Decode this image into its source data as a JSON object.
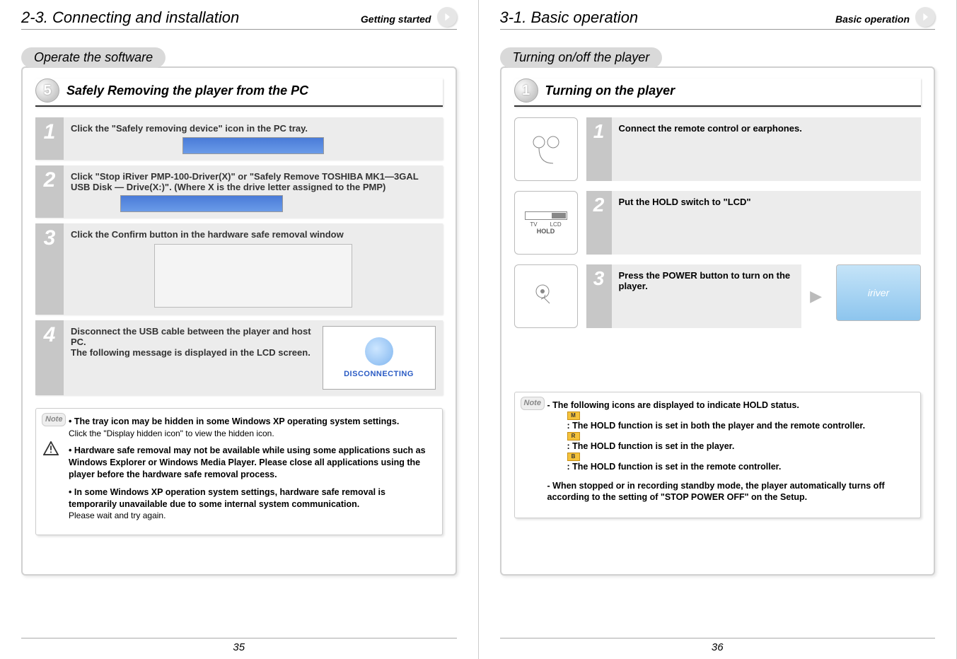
{
  "left": {
    "chapter": "2-3. Connecting and installation",
    "section": "Getting started",
    "tab": "Operate the software",
    "circleNum": "5",
    "subHeading": "Safely Removing the player from the PC",
    "steps": {
      "s1": {
        "num": "1",
        "text": "Click the \"Safely removing device\" icon in the PC tray."
      },
      "s2": {
        "num": "2",
        "text": "Click \"Stop iRiver PMP-100-Driver(X)\" or \"Safely Remove TOSHIBA MK1—3GAL USB Disk — Drive(X:)\". (Where X is the drive letter assigned to the PMP)"
      },
      "s3": {
        "num": "3",
        "text": "Click the Confirm button in the hardware safe removal window"
      },
      "s4": {
        "num": "4",
        "text": "Disconnect the USB cable between the player and host PC.\nThe following message is displayed in the LCD screen.",
        "imgLabel": "DISCONNECTING"
      }
    },
    "noteBadge": "Note",
    "notes": {
      "n1": "The tray icon may be hidden in some Windows XP operating system settings.",
      "n1sub": "Click the \"Display hidden icon\" to view the hidden icon.",
      "n2": "Hardware safe removal may not be available while using some applications such as Windows Explorer or Windows Media Player. Please close all applications using the player before the hardware safe removal process.",
      "n3": "In some Windows XP operation system settings, hardware safe removal is temporarily unavailable due to some internal system communication.",
      "n3sub": "Please wait and try again."
    },
    "pageNum": "35"
  },
  "right": {
    "chapter": "3-1. Basic operation",
    "section": "Basic operation",
    "tab": "Turning on/off the player",
    "circleNum": "1",
    "subHeading": "Turning on the player",
    "steps": {
      "s1": {
        "num": "1",
        "text": "Connect the remote control or earphones."
      },
      "s2": {
        "num": "2",
        "text": "Put the HOLD switch to \"LCD\""
      },
      "s3": {
        "num": "3",
        "text": "Press the POWER button to turn on the player."
      }
    },
    "holdLabel": "HOLD",
    "tvLabel": "TV",
    "lcdLabel": "LCD",
    "noteBadge": "Note",
    "notes": {
      "line1": "The following icons are displayed to indicate HOLD status.",
      "h1": ": The HOLD function is set in both the player and the remote controller.",
      "h2": ": The HOLD function is set in the player.",
      "h3": ": The HOLD function is set in the remote controller.",
      "line2": "When stopped or in recording standby mode, the player automatically turns off according to the setting of \"STOP POWER OFF\" on the Setup."
    },
    "iconM": "M",
    "iconR": "R",
    "iconB": "B",
    "pageNum": "36"
  }
}
